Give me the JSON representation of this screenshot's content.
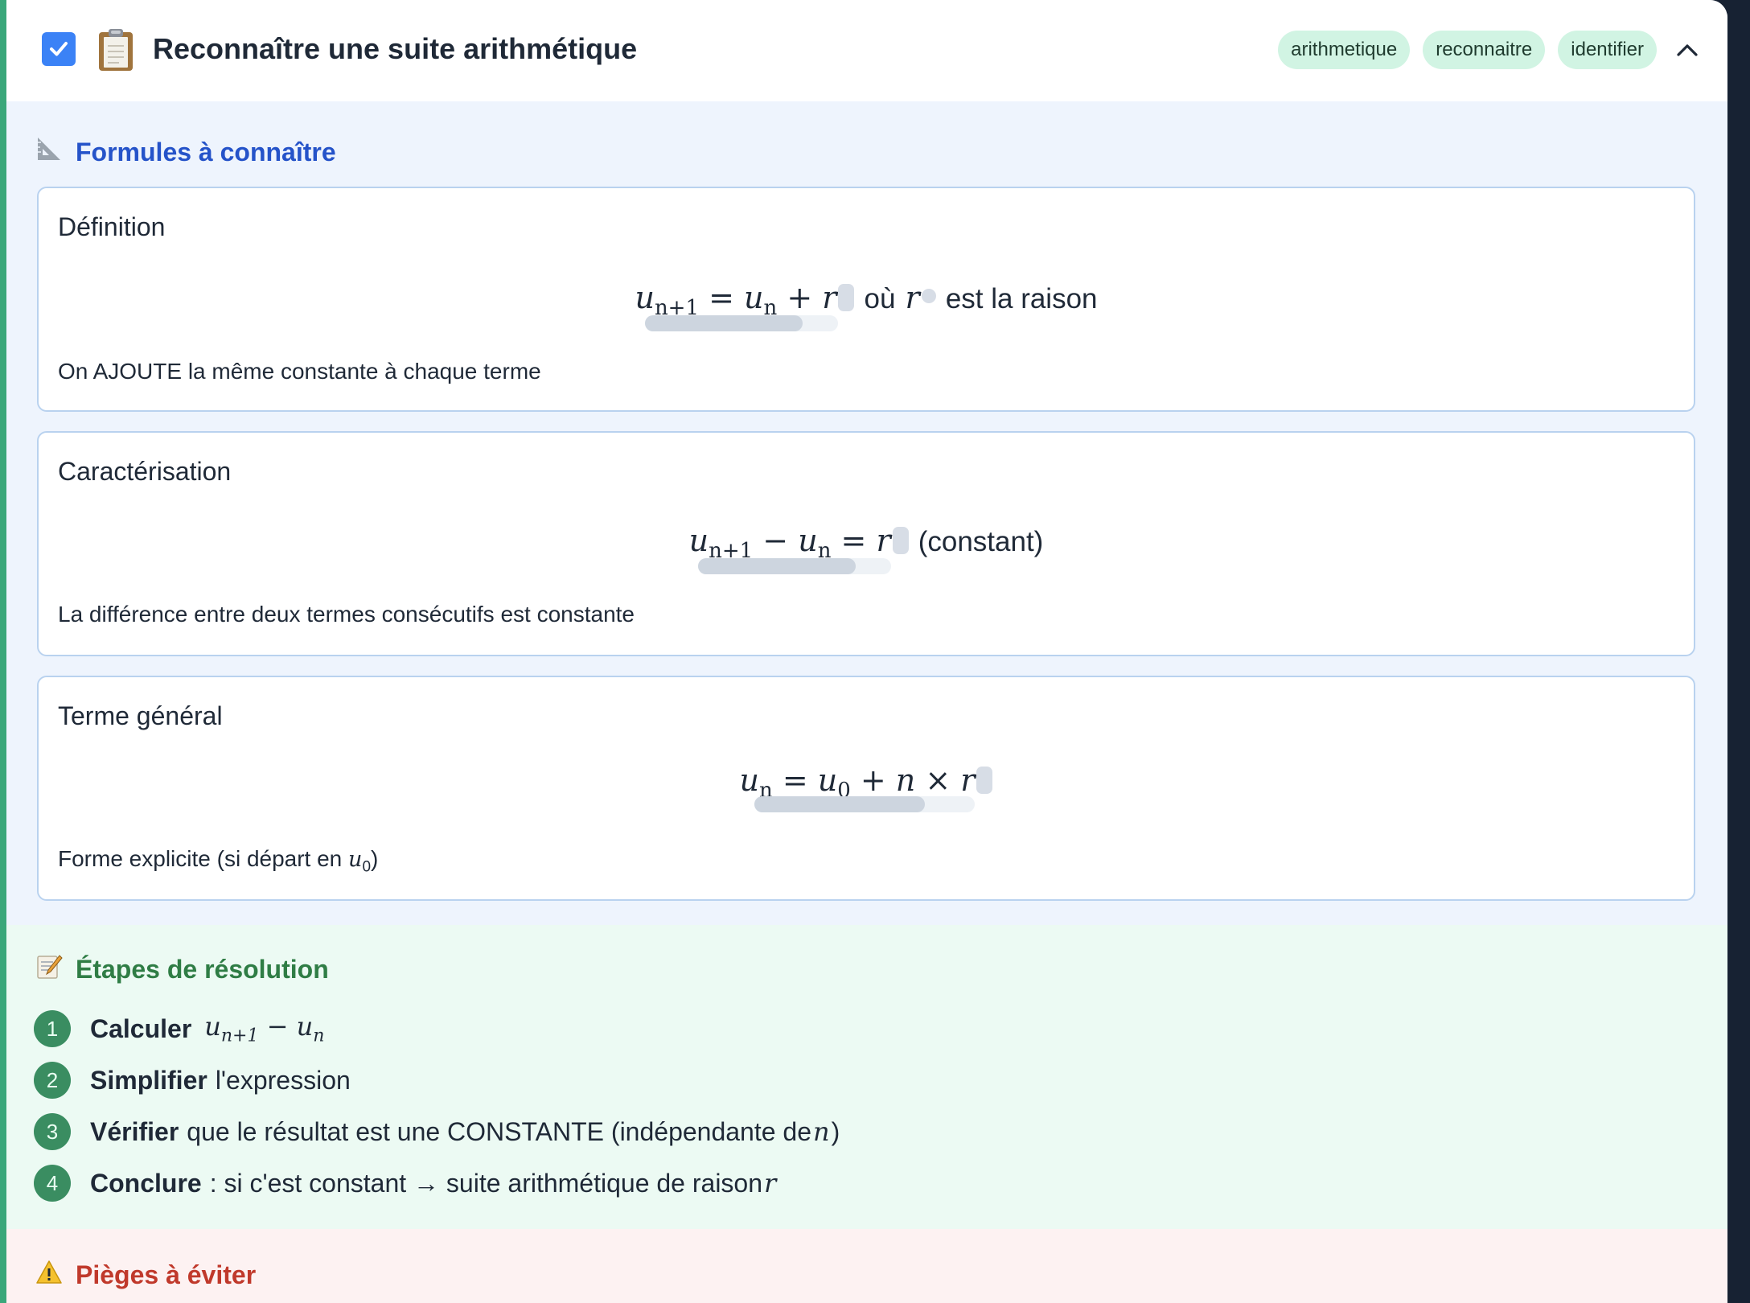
{
  "header": {
    "title": "Reconnaître une suite arithmétique",
    "checkbox_checked": true,
    "clipboard_icon": "clipboard-icon",
    "tags": [
      "arithmetique",
      "reconnaitre",
      "identifier"
    ],
    "collapse_icon": "chevron-up-icon"
  },
  "formulas": {
    "heading": "Formules à connaître",
    "icon": "triangle-ruler-icon",
    "items": [
      {
        "title": "Définition",
        "math": {
          "a": "u",
          "a_sub": "n+1",
          "eq": " = ",
          "b": "u",
          "b_sub": "n",
          "op": " + ",
          "c": "r",
          "mid": "où",
          "d": "r",
          "tail": "est la raison"
        },
        "desc": "On AJOUTE la même constante à chaque terme"
      },
      {
        "title": "Caractérisation",
        "math": {
          "a": "u",
          "a_sub": "n+1",
          "op": " − ",
          "b": "u",
          "b_sub": "n",
          "eq": " = ",
          "c": "r",
          "tail": "(constant)"
        },
        "desc": "La différence entre deux termes consécutifs est constante"
      },
      {
        "title": "Terme général",
        "math": {
          "a": "u",
          "a_sub": "n",
          "eq": " = ",
          "b": "u",
          "b_sub": "0",
          "op": " + ",
          "c": "n",
          "op2": " × ",
          "d": "r"
        },
        "desc_prefix": "Forme explicite (si départ en ",
        "desc_var": "u",
        "desc_sub": "0",
        "desc_suffix": ")"
      }
    ]
  },
  "steps": {
    "heading": "Étapes de résolution",
    "icon": "memo-icon",
    "items": [
      {
        "num": "1",
        "bold": "Calculer",
        "m1": "u",
        "m1_sub": "n+1",
        "op": " − ",
        "m2": "u",
        "m2_sub": "n"
      },
      {
        "num": "2",
        "bold": "Simplifier",
        "text": "l'expression"
      },
      {
        "num": "3",
        "bold": "Vérifier",
        "text": "que le résultat est une CONSTANTE (indépendante de ",
        "var": "n",
        "text_end": ")"
      },
      {
        "num": "4",
        "bold": "Conclure",
        "text": ": si c'est constant → suite arithmétique de raison ",
        "var": "r"
      }
    ]
  },
  "pitfalls": {
    "heading": "Pièges à éviter",
    "icon": "warning-icon"
  },
  "colors": {
    "accent_green": "#3aa77a",
    "blue_heading": "#2553c9",
    "green_heading": "#2f7d45",
    "red_heading": "#c0392b",
    "checkbox_blue": "#3b82f6",
    "tag_bg": "#d1f4e3"
  }
}
